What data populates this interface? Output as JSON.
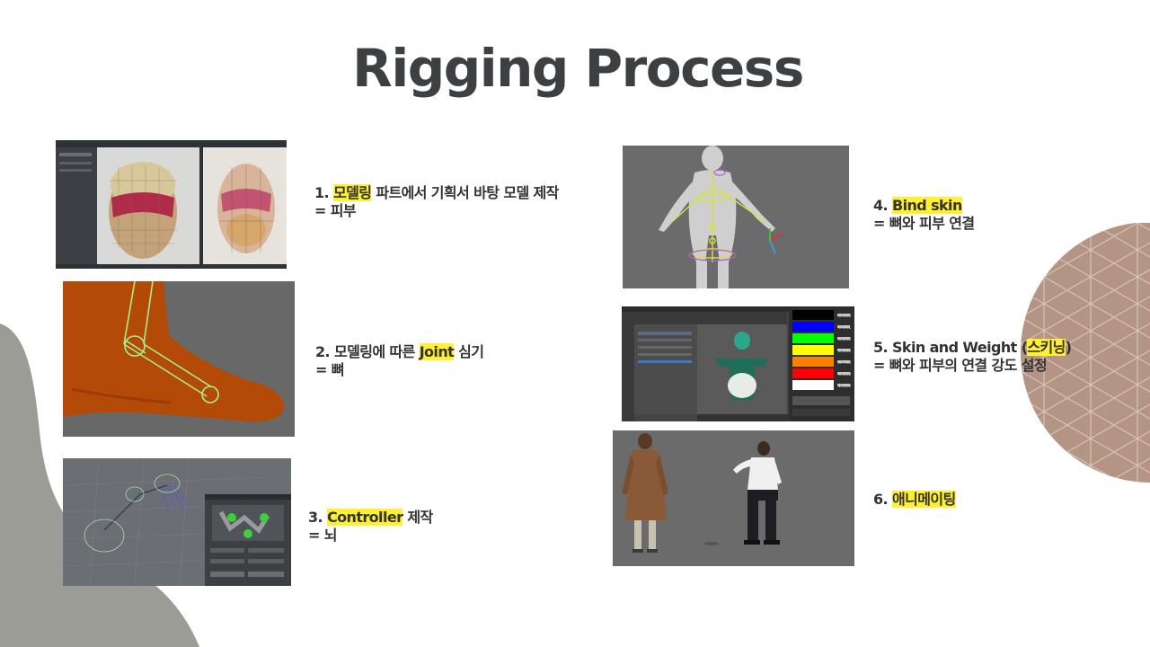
{
  "slide": {
    "title": "Rigging Process",
    "accent_highlight": "#fff030",
    "title_color": "#3c4043",
    "steps": [
      {
        "num": "1.",
        "highlight": "모델링",
        "rest": "파트에서 기획서 바탕 모델 제작",
        "line2": "= 피부"
      },
      {
        "num": "2.",
        "pre": "모델링에 따른",
        "highlight": "Joint",
        "rest": "심기",
        "line2": "= 뼈"
      },
      {
        "num": "3.",
        "highlight": "Controller",
        "rest": "제작",
        "line2": "= 뇌"
      },
      {
        "num": "4.",
        "highlight": "Bind skin",
        "rest": "",
        "line2": "= 뼈와 피부 연결"
      },
      {
        "num": "5.",
        "pre": "Skin and Weight (",
        "highlight": "스키닝",
        "rest": ")",
        "line2": "= 뼈와 피부의 연결 강도 설정"
      },
      {
        "num": "6.",
        "highlight": "애니메이팅",
        "rest": "",
        "line2": ""
      }
    ],
    "weight_table": [
      "#000000",
      "#0000FF",
      "#00FF00",
      "#FFFF00",
      "#FF8000",
      "#FF0000",
      "#FFFFFF"
    ],
    "weight_values": [
      "0.000",
      "0.061",
      "0.250",
      "0.500",
      "0.750",
      "0.909",
      "1.000"
    ]
  }
}
